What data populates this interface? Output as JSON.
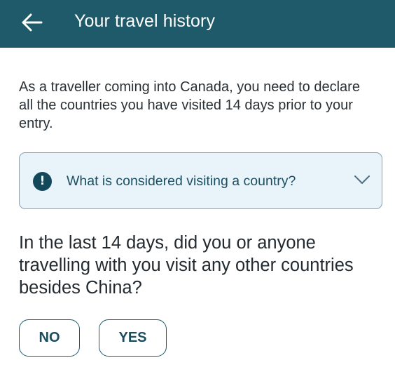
{
  "header": {
    "title": "Your travel history",
    "back_icon": "arrow-left-icon"
  },
  "intro": {
    "text": "As a traveller coming into Canada, you need to declare all the countries you have visited 14 days prior to your entry."
  },
  "accordion": {
    "icon": "info-icon",
    "icon_glyph": "!",
    "label": "What is considered visiting a country?",
    "expanded": false,
    "chevron_icon": "chevron-down-icon"
  },
  "question": {
    "text": "In the last 14 days, did you or anyone travelling with you visit any other countries besides China?"
  },
  "answers": {
    "no_label": "NO",
    "yes_label": "YES"
  },
  "colors": {
    "app_bar": "#1f5a6b",
    "accordion_bg": "#e9f3fa",
    "accordion_border": "#7fa6bc",
    "accent_text": "#1d4f63"
  }
}
